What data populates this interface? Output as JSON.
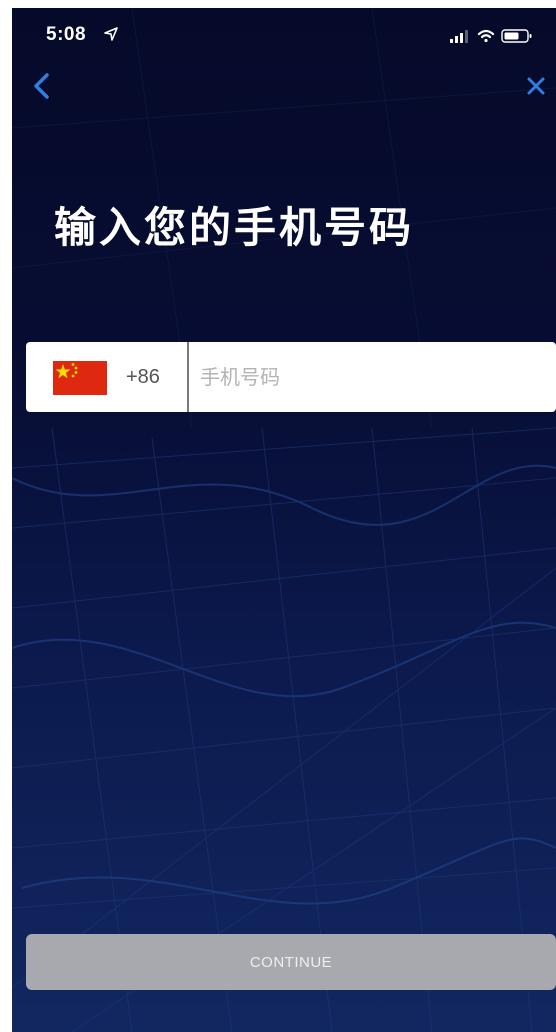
{
  "status_bar": {
    "time": "5:08",
    "location_icon": "location-arrow-icon",
    "signal_icon": "cellular-signal-icon",
    "wifi_icon": "wifi-icon",
    "battery_icon": "battery-icon"
  },
  "nav": {
    "back_icon": "chevron-left-icon",
    "close_icon": "close-icon",
    "icon_color": "#2f7ee0"
  },
  "title": "输入您的手机号码",
  "phone_form": {
    "country_flag": "china-flag-icon",
    "dial_code": "+86",
    "phone_placeholder": "手机号码",
    "phone_value": ""
  },
  "continue_label": "CONTINUE",
  "colors": {
    "background_top": "#060a2a",
    "background_bottom": "#122760",
    "button_disabled": "#a7a9ae",
    "flag_red": "#de2910",
    "flag_yellow": "#ffde00"
  }
}
